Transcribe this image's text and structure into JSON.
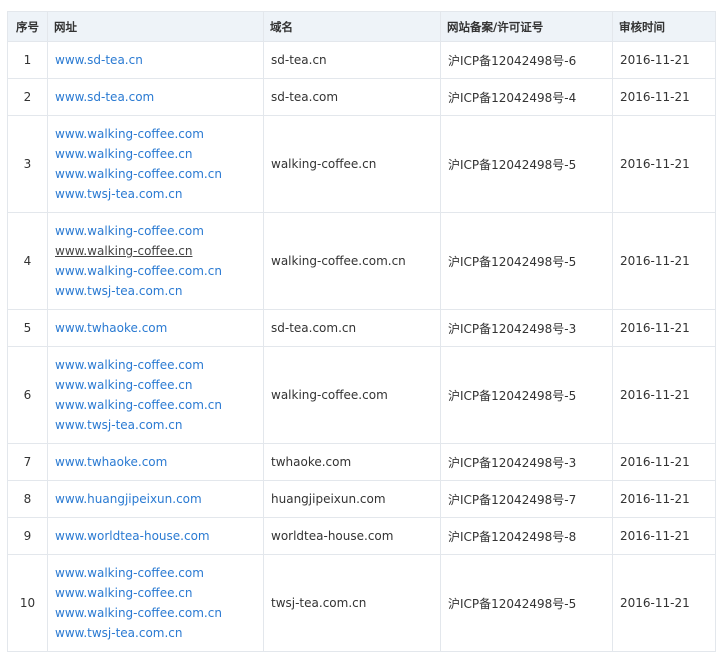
{
  "headers": {
    "no": "序号",
    "url": "网址",
    "domain": "域名",
    "icp": "网站备案/许可证号",
    "date": "审核时间"
  },
  "rows": [
    {
      "no": "1",
      "urls": [
        "www.sd-tea.cn"
      ],
      "domain": "sd-tea.cn",
      "icp": "沪ICP备12042498号-6",
      "date": "2016-11-21"
    },
    {
      "no": "2",
      "urls": [
        "www.sd-tea.com"
      ],
      "domain": "sd-tea.com",
      "icp": "沪ICP备12042498号-4",
      "date": "2016-11-21"
    },
    {
      "no": "3",
      "urls": [
        "www.walking-coffee.com",
        "www.walking-coffee.cn",
        "www.walking-coffee.com.cn",
        "www.twsj-tea.com.cn"
      ],
      "domain": "walking-coffee.cn",
      "icp": "沪ICP备12042498号-5",
      "date": "2016-11-21"
    },
    {
      "no": "4",
      "urls": [
        "www.walking-coffee.com",
        "www.walking-coffee.cn",
        "www.walking-coffee.com.cn",
        "www.twsj-tea.com.cn"
      ],
      "domain": "walking-coffee.com.cn",
      "icp": "沪ICP备12042498号-5",
      "date": "2016-11-21"
    },
    {
      "no": "5",
      "urls": [
        "www.twhaoke.com"
      ],
      "domain": "sd-tea.com.cn",
      "icp": "沪ICP备12042498号-3",
      "date": "2016-11-21"
    },
    {
      "no": "6",
      "urls": [
        "www.walking-coffee.com",
        "www.walking-coffee.cn",
        "www.walking-coffee.com.cn",
        "www.twsj-tea.com.cn"
      ],
      "domain": "walking-coffee.com",
      "icp": "沪ICP备12042498号-5",
      "date": "2016-11-21"
    },
    {
      "no": "7",
      "urls": [
        "www.twhaoke.com"
      ],
      "domain": "twhaoke.com",
      "icp": "沪ICP备12042498号-3",
      "date": "2016-11-21"
    },
    {
      "no": "8",
      "urls": [
        "www.huangjipeixun.com"
      ],
      "domain": "huangjipeixun.com",
      "icp": "沪ICP备12042498号-7",
      "date": "2016-11-21"
    },
    {
      "no": "9",
      "urls": [
        "www.worldtea-house.com"
      ],
      "domain": "worldtea-house.com",
      "icp": "沪ICP备12042498号-8",
      "date": "2016-11-21"
    },
    {
      "no": "10",
      "urls": [
        "www.walking-coffee.com",
        "www.walking-coffee.cn",
        "www.walking-coffee.com.cn",
        "www.twsj-tea.com.cn"
      ],
      "domain": "twsj-tea.com.cn",
      "icp": "沪ICP备12042498号-5",
      "date": "2016-11-21"
    }
  ],
  "colors": {
    "link": "#2a7ad2",
    "header_bg": "#eef3f8",
    "border": "#e3e7ec"
  }
}
